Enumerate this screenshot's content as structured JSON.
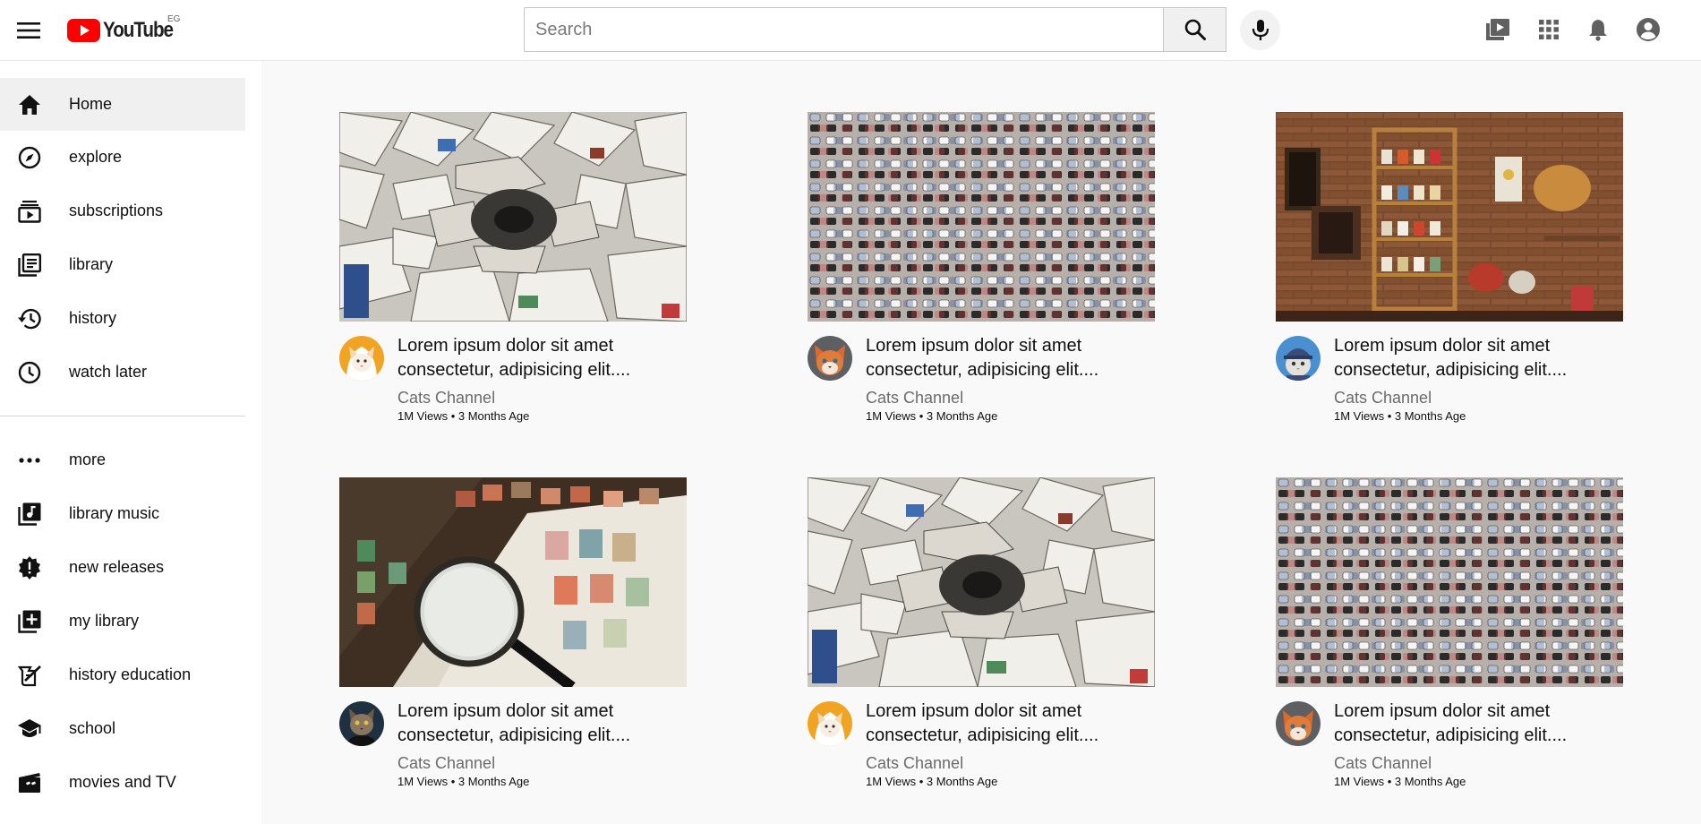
{
  "header": {
    "logo_text": "YouTube",
    "country_code": "EG",
    "search": {
      "placeholder": "Search",
      "value": ""
    },
    "brand_red": "#ff0000",
    "icons": [
      "menu-icon",
      "search-icon",
      "mic-icon",
      "create-video-icon",
      "apps-grid-icon",
      "notifications-bell-icon",
      "account-circle-icon"
    ]
  },
  "sidebar": {
    "items": [
      {
        "label": "Home",
        "icon": "home-icon",
        "active": true
      },
      {
        "label": "explore",
        "icon": "compass-icon"
      },
      {
        "label": "subscriptions",
        "icon": "subscriptions-icon"
      },
      {
        "label": "library",
        "icon": "library-icon"
      },
      {
        "label": "history",
        "icon": "history-icon"
      },
      {
        "label": "watch later",
        "icon": "clock-icon"
      }
    ],
    "more_items": [
      {
        "label": "more",
        "icon": "more-dots-icon"
      },
      {
        "label": "library music",
        "icon": "library-music-icon"
      },
      {
        "label": "new releases",
        "icon": "new-releases-icon"
      },
      {
        "label": "my library",
        "icon": "library-add-icon"
      },
      {
        "label": "history education",
        "icon": "history-edu-icon"
      },
      {
        "label": "school",
        "icon": "school-icon"
      },
      {
        "label": "movies and TV",
        "icon": "movie-icon"
      }
    ]
  },
  "videos": [
    {
      "title_line1": "Lorem ipsum dolor sit amet",
      "title_line2": "consectetur, adipisicing elit....",
      "channel": "Cats Channel",
      "meta": "1M Views • 3 Months Age",
      "thumbnail": "newspapers-pile",
      "avatar": "cat-orange-hood"
    },
    {
      "title_line1": "Lorem ipsum dolor sit amet",
      "title_line2": "consectetur, adipisicing elit....",
      "channel": "Cats Channel",
      "meta": "1M Views • 3 Months Age",
      "thumbnail": "parking-lot-aerial",
      "avatar": "cat-fox"
    },
    {
      "title_line1": "Lorem ipsum dolor sit amet",
      "title_line2": "consectetur, adipisicing elit....",
      "channel": "Cats Channel",
      "meta": "1M Views • 3 Months Age",
      "thumbnail": "mugs-brick-wall",
      "avatar": "cat-cap-blue"
    },
    {
      "title_line1": "Lorem ipsum dolor sit amet",
      "title_line2": "consectetur, adipisicing elit....",
      "channel": "Cats Channel",
      "meta": "1M Views • 3 Months Age",
      "thumbnail": "stamps-magnifier",
      "avatar": "cat-dark-coat"
    },
    {
      "title_line1": "Lorem ipsum dolor sit amet",
      "title_line2": "consectetur, adipisicing elit....",
      "channel": "Cats Channel",
      "meta": "1M Views • 3 Months Age",
      "thumbnail": "newspapers-pile",
      "avatar": "cat-orange-hood"
    },
    {
      "title_line1": "Lorem ipsum dolor sit amet",
      "title_line2": "consectetur, adipisicing elit....",
      "channel": "Cats Channel",
      "meta": "1M Views • 3 Months Age",
      "thumbnail": "parking-lot-aerial",
      "avatar": "cat-fox"
    }
  ]
}
